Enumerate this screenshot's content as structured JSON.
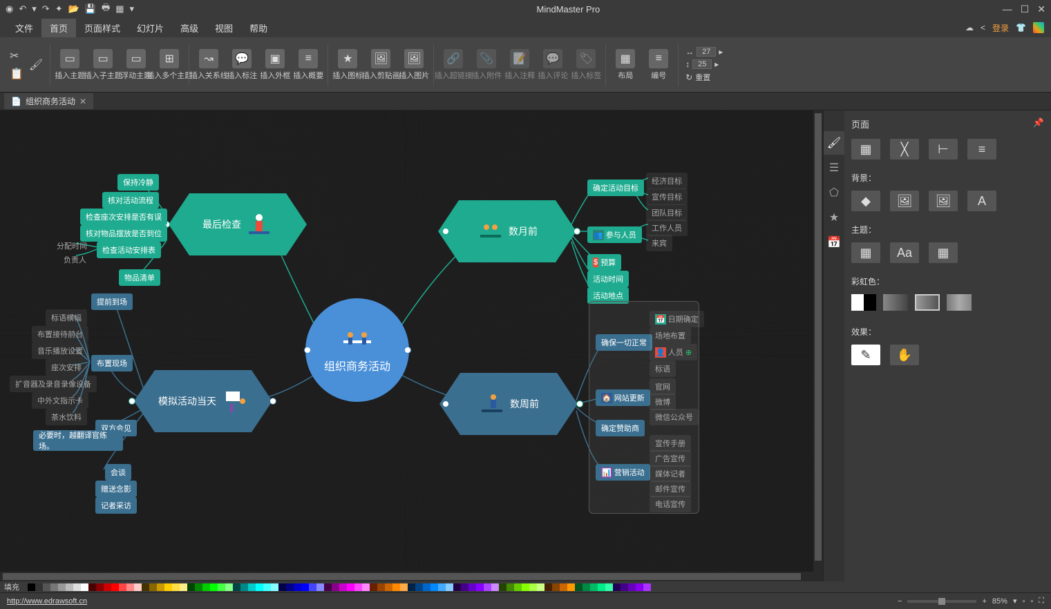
{
  "app_title": "MindMaster Pro",
  "menu": {
    "file": "文件",
    "home": "首页",
    "page_format": "页面样式",
    "slide": "幻灯片",
    "advanced": "高级",
    "view": "视图",
    "help": "帮助",
    "login": "登录"
  },
  "ribbon": {
    "insert_topic": "插入主题",
    "insert_subtopic": "插入子主题",
    "floating_topic": "浮动主题",
    "multiple_topics": "插入多个主题",
    "relationship": "插入关系线",
    "callout": "插入标注",
    "boundary": "插入外框",
    "summary": "插入概要",
    "icon": "插入图标",
    "clipart": "插入剪贴画",
    "image": "插入图片",
    "hyperlink": "插入超链接",
    "attachment": "插入附件",
    "note": "插入注释",
    "comment": "插入评论",
    "tag": "插入标签",
    "layout": "布局",
    "numbering": "编号",
    "width_val": "27",
    "height_val": "25",
    "reset": "重置"
  },
  "doc_tab": "组织商务活动",
  "center": "组织商务活动",
  "topleft": {
    "main": "最后检查",
    "items": [
      "保持冷静",
      "核对活动流程",
      "检查座次安排是否有误",
      "核对物品摆放是否到位",
      "检查活动安排表",
      "物品清单"
    ],
    "side": [
      "分配时间",
      "负责人"
    ]
  },
  "topright": {
    "main": "数月前",
    "items": [
      "确定活动目标",
      "参与人员",
      "预算",
      "活动时间",
      "活动地点"
    ],
    "sub": [
      "经济目标",
      "宣传目标",
      "团队目标",
      "工作人员",
      "来宾"
    ]
  },
  "botleft": {
    "main": "模拟活动当天",
    "pre": "提前到场",
    "items": [
      "标语横幅",
      "布置接待前台",
      "音乐播放设置",
      "座次安排",
      "扩音器及录音录像设备",
      "中外文指示卡",
      "茶水饮料"
    ],
    "mid": "布置现场",
    "meet": [
      "双方会见",
      "会谈",
      "赠送念影",
      "记者采访"
    ],
    "note": "必要时，越翻译官练场。"
  },
  "botright": {
    "main": "数周前",
    "grp1": "确保一切正常",
    "grp1_items": [
      "日期确定",
      "场地布置",
      "人员",
      "标语"
    ],
    "grp2": "网站更新",
    "grp2_items": [
      "官网",
      "微博",
      "微信公众号"
    ],
    "grp3": "确定赞助商",
    "grp4": "营销活动",
    "grp4_items": [
      "宣传手册",
      "广告宣传",
      "媒体记者",
      "邮件宣传",
      "电话宣传"
    ]
  },
  "right_panel": {
    "title": "页面",
    "bg": "背景：",
    "theme": "主题：",
    "rainbow": "彩虹色：",
    "effect": "效果："
  },
  "status": {
    "fill": "填充",
    "url": "http://www.edrawsoft.cn",
    "zoom": "85%"
  }
}
